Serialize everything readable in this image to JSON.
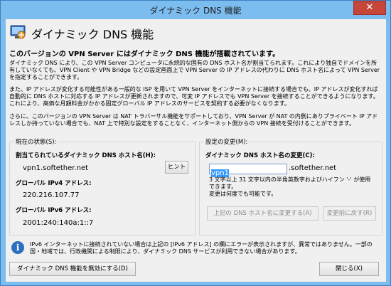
{
  "window": {
    "title": "ダイナミック DNS 機能",
    "close_label": "✕"
  },
  "header": {
    "title": "ダイナミック DNS 機能"
  },
  "subtitle": "このバージョンの VPN Server にはダイナミック DNS 機能が搭載されています。",
  "paragraphs": {
    "p1": "ダイナミック DNS により、この VPN Server コンピュータに永続的な固有の DNS ホスト名が割当てられます。これにより独自でドメインを所有していなくても、VPN Client や VPN Bridge などの設定画面上で VPN Server の IP アドレスの代わりに DNS ホスト名によって VPN Server を指定することができます。",
    "p2": "また、IP アドレスが変化する可能性がある一般的な ISP を用いて VPN Server をインターネットに接続する場合でも、IP アドレスが変化すれば自動的に DNS ホストに対応する IP アドレスが更新されますので、可変 IP アドレスでも VPN Server を接続することができるようになります。これにより、高価な月額料金がかかる固定グローバル IP アドレスのサービスを契約する必要がなくなります。",
    "p3": "さらに、このバージョンの VPN Server は NAT トラバーサル機能をサポートしており、VPN Server が NAT の内側にありプライベート IP アドレスしか持っていない場合でも、NAT 上で特別な設定をすることなく、インターネット側からの VPN 接続を受付けることができます。"
  },
  "status_group": {
    "label": "現在の状態(S):",
    "hostname_label": "割当てられているダイナミック DNS ホスト名(H):",
    "hostname_value": "vpn1.softether.net",
    "hint_button": "ヒント",
    "ipv4_label": "グローバル IPv4 アドレス:",
    "ipv4_value": "220.216.107.77",
    "ipv6_label": "グローバル IPv6 アドレス:",
    "ipv6_value": "2001:240:140a:1::7"
  },
  "change_group": {
    "label": "設定の変更(M):",
    "change_label": "ダイナミック DNS ホスト名の変更(C):",
    "input_value": "vpn1",
    "suffix": ".softether.net",
    "rule_line1": "3 文字以上 31 文字以内の半角英数字およびハイフン '-' が使用",
    "rule_line2": "できます。",
    "rule_line3": "変更は何度でも可能です。",
    "apply_button": "上記の DNS ホスト名に変更する(A)",
    "revert_button": "変更前に戻す(R)"
  },
  "info": {
    "text": "IPv6 インターネットに接続されていない場合は上記の [IPv6 アドレス] の欄にエラーが表示されますが、異常ではありません。一部の国・地域では、行政機関による制限により、ダイナミック DNS サービスが利用できない場合があります。"
  },
  "footer": {
    "disable_button": "ダイナミック DNS 機能を無効にする(D)",
    "close_button": "閉じる(X)"
  }
}
